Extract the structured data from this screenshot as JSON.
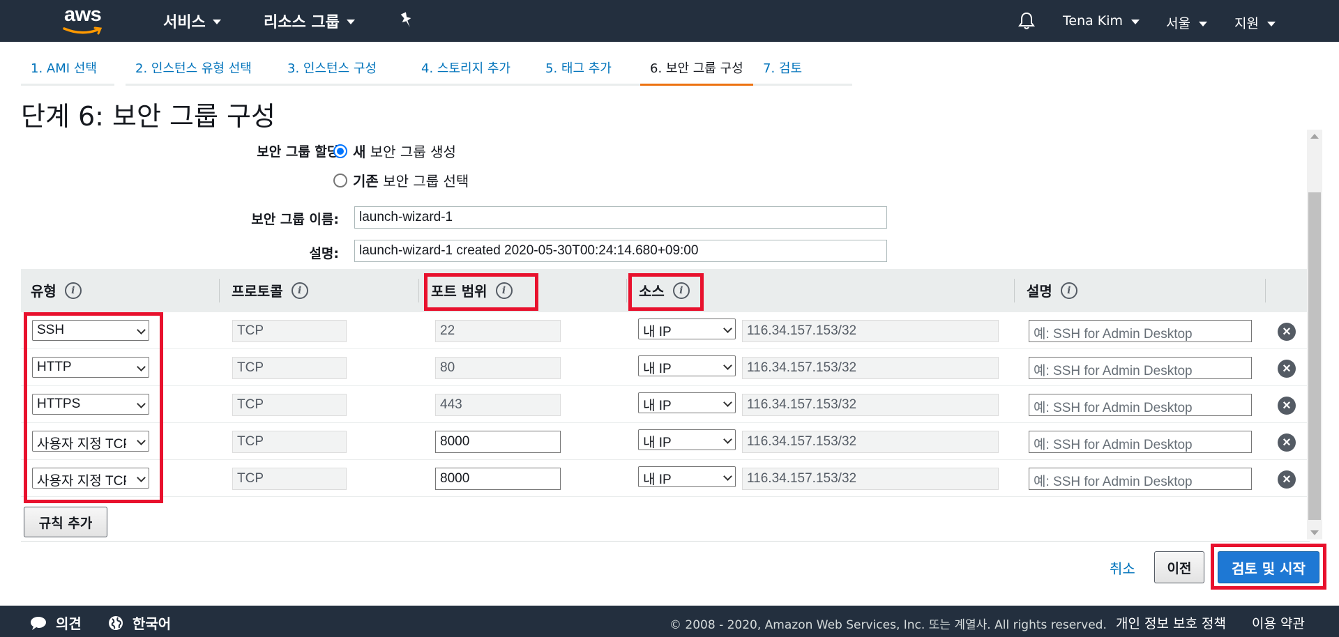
{
  "topnav": {
    "logo": "aws",
    "services": "서비스",
    "resource_groups": "리소스 그룹",
    "user": "Tena Kim",
    "region": "서울",
    "support": "지원"
  },
  "steps": [
    {
      "label": "1. AMI 선택"
    },
    {
      "label": "2. 인스턴스 유형 선택"
    },
    {
      "label": "3. 인스턴스 구성"
    },
    {
      "label": "4. 스토리지 추가"
    },
    {
      "label": "5. 태그 추가"
    },
    {
      "label": "6. 보안 그룹 구성"
    },
    {
      "label": "7. 검토"
    }
  ],
  "page_title": "단계 6: 보안 그룹 구성",
  "form": {
    "assign_label": "보안 그룹 할당:",
    "option_new_bold": "새",
    "option_new_rest": " 보안 그룹 생성",
    "option_existing_bold": "기존",
    "option_existing_rest": " 보안 그룹 선택",
    "name_label": "보안 그룹 이름:",
    "name_value": "launch-wizard-1",
    "desc_label": "설명:",
    "desc_value": "launch-wizard-1 created 2020-05-30T00:24:14.680+09:00"
  },
  "table": {
    "headers": {
      "type": "유형",
      "protocol": "프로토콜",
      "port_range": "포트 범위",
      "source": "소스",
      "description": "설명"
    },
    "info_icon": "i",
    "rows": [
      {
        "type": "SSH",
        "protocol": "TCP",
        "port": "22",
        "source_type": "내 IP",
        "source_cidr": "116.34.157.153/32",
        "desc_placeholder": "예: SSH for Admin Desktop"
      },
      {
        "type": "HTTP",
        "protocol": "TCP",
        "port": "80",
        "source_type": "내 IP",
        "source_cidr": "116.34.157.153/32",
        "desc_placeholder": "예: SSH for Admin Desktop"
      },
      {
        "type": "HTTPS",
        "protocol": "TCP",
        "port": "443",
        "source_type": "내 IP",
        "source_cidr": "116.34.157.153/32",
        "desc_placeholder": "예: SSH for Admin Desktop"
      },
      {
        "type": "사용자 지정 TCP",
        "protocol": "TCP",
        "port": "8000",
        "source_type": "내 IP",
        "source_cidr": "116.34.157.153/32",
        "desc_placeholder": "예: SSH for Admin Desktop"
      },
      {
        "type": "사용자 지정 TCP",
        "protocol": "TCP",
        "port": "8000",
        "source_type": "내 IP",
        "source_cidr": "116.34.157.153/32",
        "desc_placeholder": "예: SSH for Admin Desktop"
      }
    ],
    "remove_glyph": "×"
  },
  "add_rule": "규칙 추가",
  "actions": {
    "cancel": "취소",
    "previous": "이전",
    "review_launch": "검토 및 시작"
  },
  "footer": {
    "feedback": "의견",
    "language": "한국어",
    "copyright": "© 2008 - 2020, Amazon Web Services, Inc. 또는 계열사. All rights reserved.",
    "privacy": "개인 정보 보호 정책",
    "terms": "이용 약관"
  },
  "colors": {
    "nav_bg": "#232f3e",
    "accent_orange": "#ec7211",
    "link_blue": "#0073bb",
    "primary_button": "#1e78d4",
    "highlight_red": "#e8112d"
  }
}
